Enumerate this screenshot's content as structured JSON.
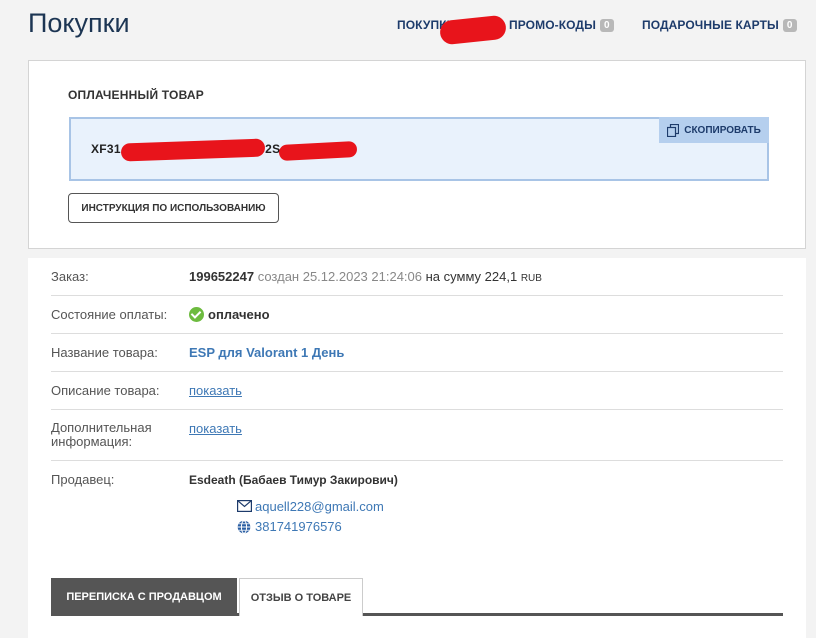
{
  "header": {
    "title": "Покупки",
    "nav": [
      {
        "label": "ПОКУПКИ",
        "badge": ""
      },
      {
        "label": "ПРОМО-КОДЫ",
        "badge": "0"
      },
      {
        "label": "ПОДАРОЧНЫЕ КАРТЫ",
        "badge": "0"
      }
    ]
  },
  "product_card": {
    "title": "ОПЛАЧЕННЫЙ ТОВАР",
    "code_visible": "XF31",
    "code_mid": "32S",
    "copy_label": "СКОПИРОВАТЬ",
    "instruction_label": "ИНСТРУКЦИЯ ПО ИСПОЛЬЗОВАНИЮ"
  },
  "details": {
    "order": {
      "label": "Заказ:",
      "number": "199652247",
      "created_text": "создан 25.12.2023 21:24:06",
      "sum_prefix": "на сумму",
      "sum": "224,1",
      "currency": "RUB"
    },
    "payment": {
      "label": "Состояние оплаты:",
      "value": "оплачено"
    },
    "product_name": {
      "label": "Название товара:",
      "value": "ESP для Valorant 1 День"
    },
    "description": {
      "label": "Описание товара:",
      "link": "показать"
    },
    "additional": {
      "label_line1": "Дополнительная",
      "label_line2": "информация:",
      "link": "показать"
    },
    "seller": {
      "label": "Продавец:",
      "name": "Esdeath (Бабаев Тимур Закирович)",
      "email": "aquell228@gmail.com",
      "wmid": "381741976576"
    }
  },
  "tabs": [
    {
      "label": "ПЕРЕПИСКА С ПРОДАВЦОМ",
      "active": true
    },
    {
      "label": "ОТЗЫВ О ТОВАРЕ",
      "active": false
    }
  ],
  "colors": {
    "accent": "#3e78b5",
    "nav": "#1d3b6b",
    "paid": "#6dbb3f",
    "redaction": "#e8141b"
  }
}
